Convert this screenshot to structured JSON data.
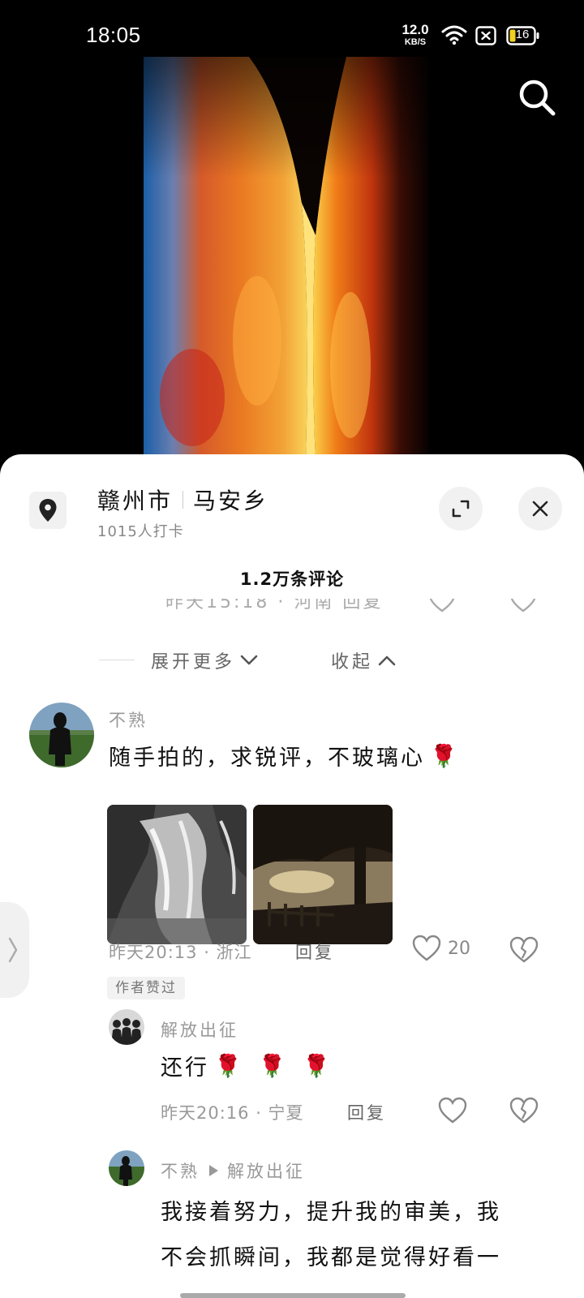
{
  "status_bar": {
    "time": "18:05",
    "net_speed_value": "12.0",
    "net_speed_unit": "KB/S",
    "battery_level": "16",
    "icons": [
      "wifi-icon",
      "sim-x-icon",
      "battery-icon"
    ]
  },
  "header": {
    "icons": [
      "search-icon"
    ]
  },
  "location": {
    "city": "赣州市",
    "place": "马安乡",
    "checkins": "1015人打卡"
  },
  "comments_count": "1.2万条评论",
  "clipped_row": {
    "text": "昨天15:18 · 河南    回复"
  },
  "expand": {
    "more_label": "展开更多",
    "collapse_label": "收起"
  },
  "main_comment": {
    "username": "不熟",
    "text": "随手拍的，求锐评，不玻璃心",
    "emoji": "🌹",
    "meta": "昨天20:13 · 浙江",
    "reply_label": "回复",
    "like_count": "20",
    "author_liked": "作者赞过",
    "images": [
      "waterfall-photo",
      "sunset-lake-photo"
    ]
  },
  "replies": [
    {
      "username": "解放出征",
      "text": "还行",
      "emojis": [
        "🌹",
        "🌹",
        "🌹"
      ],
      "meta": "昨天20:16 · 宁夏",
      "reply_label": "回复"
    },
    {
      "username": "不熟",
      "reply_to": "解放出征",
      "text_line1": "我接着努力，提升我的审美，我",
      "text_line2": "不会抓瞬间，我都是觉得好看一"
    }
  ],
  "colors": {
    "sheet_bg": "#ffffff",
    "muted_text": "#999999",
    "primary_text": "#111111",
    "pill_bg": "#f1f1f1"
  }
}
